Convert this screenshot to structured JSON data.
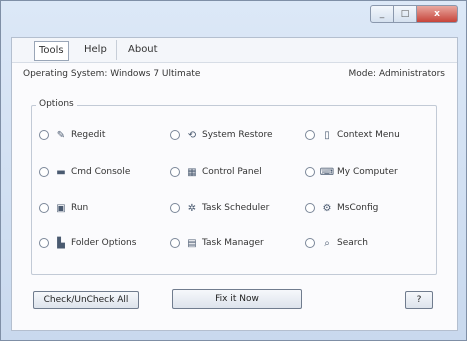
{
  "window": {
    "close_symbol": "x"
  },
  "menu": {
    "items": [
      {
        "label": "Tools"
      },
      {
        "label": "Help"
      },
      {
        "label": "About"
      }
    ]
  },
  "status": {
    "left": "Operating System: Windows 7 Ultimate",
    "right": "Mode: Administrators"
  },
  "options": {
    "title": "Options",
    "items": [
      {
        "label": "Regedit",
        "icon": "regedit-icon",
        "glyph": "✎"
      },
      {
        "label": "System Restore",
        "icon": "system-restore-icon",
        "glyph": "⟲"
      },
      {
        "label": "Context Menu",
        "icon": "context-menu-icon",
        "glyph": "▯"
      },
      {
        "label": "Cmd Console",
        "icon": "cmd-console-icon",
        "glyph": "▬"
      },
      {
        "label": "Control Panel",
        "icon": "control-panel-icon",
        "glyph": "▦"
      },
      {
        "label": "My Computer",
        "icon": "my-computer-icon",
        "glyph": "⌨"
      },
      {
        "label": "Run",
        "icon": "run-icon",
        "glyph": "▣"
      },
      {
        "label": "Task Scheduler",
        "icon": "task-scheduler-icon",
        "glyph": "✲"
      },
      {
        "label": "MsConfig",
        "icon": "msconfig-icon",
        "glyph": "⚙"
      },
      {
        "label": "Folder Options",
        "icon": "folder-options-icon",
        "glyph": "▙"
      },
      {
        "label": "Task Manager",
        "icon": "task-manager-icon",
        "glyph": "▤"
      },
      {
        "label": "Search",
        "icon": "search-icon",
        "glyph": "⌕"
      }
    ]
  },
  "buttons": {
    "check_all": "Check/UnCheck All",
    "fix": "Fix it Now",
    "info": "?"
  }
}
